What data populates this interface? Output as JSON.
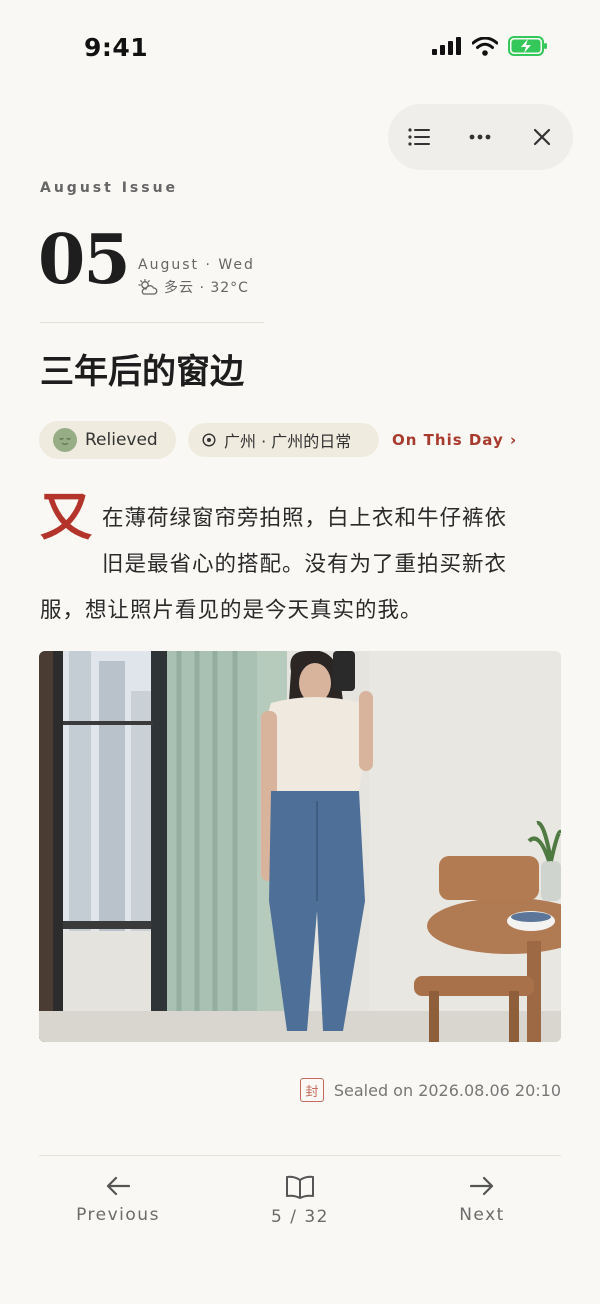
{
  "status_bar": {
    "time": "9:41"
  },
  "toolbar": {
    "icons": [
      "list-icon",
      "more-icon",
      "close-icon"
    ]
  },
  "header": {
    "issue": "August Issue",
    "day": "05",
    "month_weekday": "August · Wed",
    "weather": "多云 · 32°C",
    "weather_icon": "partly-cloudy-icon"
  },
  "entry": {
    "title": "三年后的窗边",
    "mood": "Relieved",
    "location": "广州 · 广州的日常",
    "on_this_day": "On This Day ›",
    "drop_cap": "又",
    "line1": "在薄荷绿窗帘旁拍照，白上衣和牛仔裤依",
    "line2": "旧是最省心的搭配。没有为了重拍买新衣",
    "line3": "服，想让照片看见的是今天真实的我。"
  },
  "seal": {
    "stamp": "封",
    "text": "Sealed on 2026.08.06 20:10"
  },
  "footer": {
    "previous": "Previous",
    "page": "5 / 32",
    "next": "Next"
  },
  "colors": {
    "accent": "#a83a2e",
    "background": "#f9f8f4",
    "chip": "#efebdf"
  }
}
